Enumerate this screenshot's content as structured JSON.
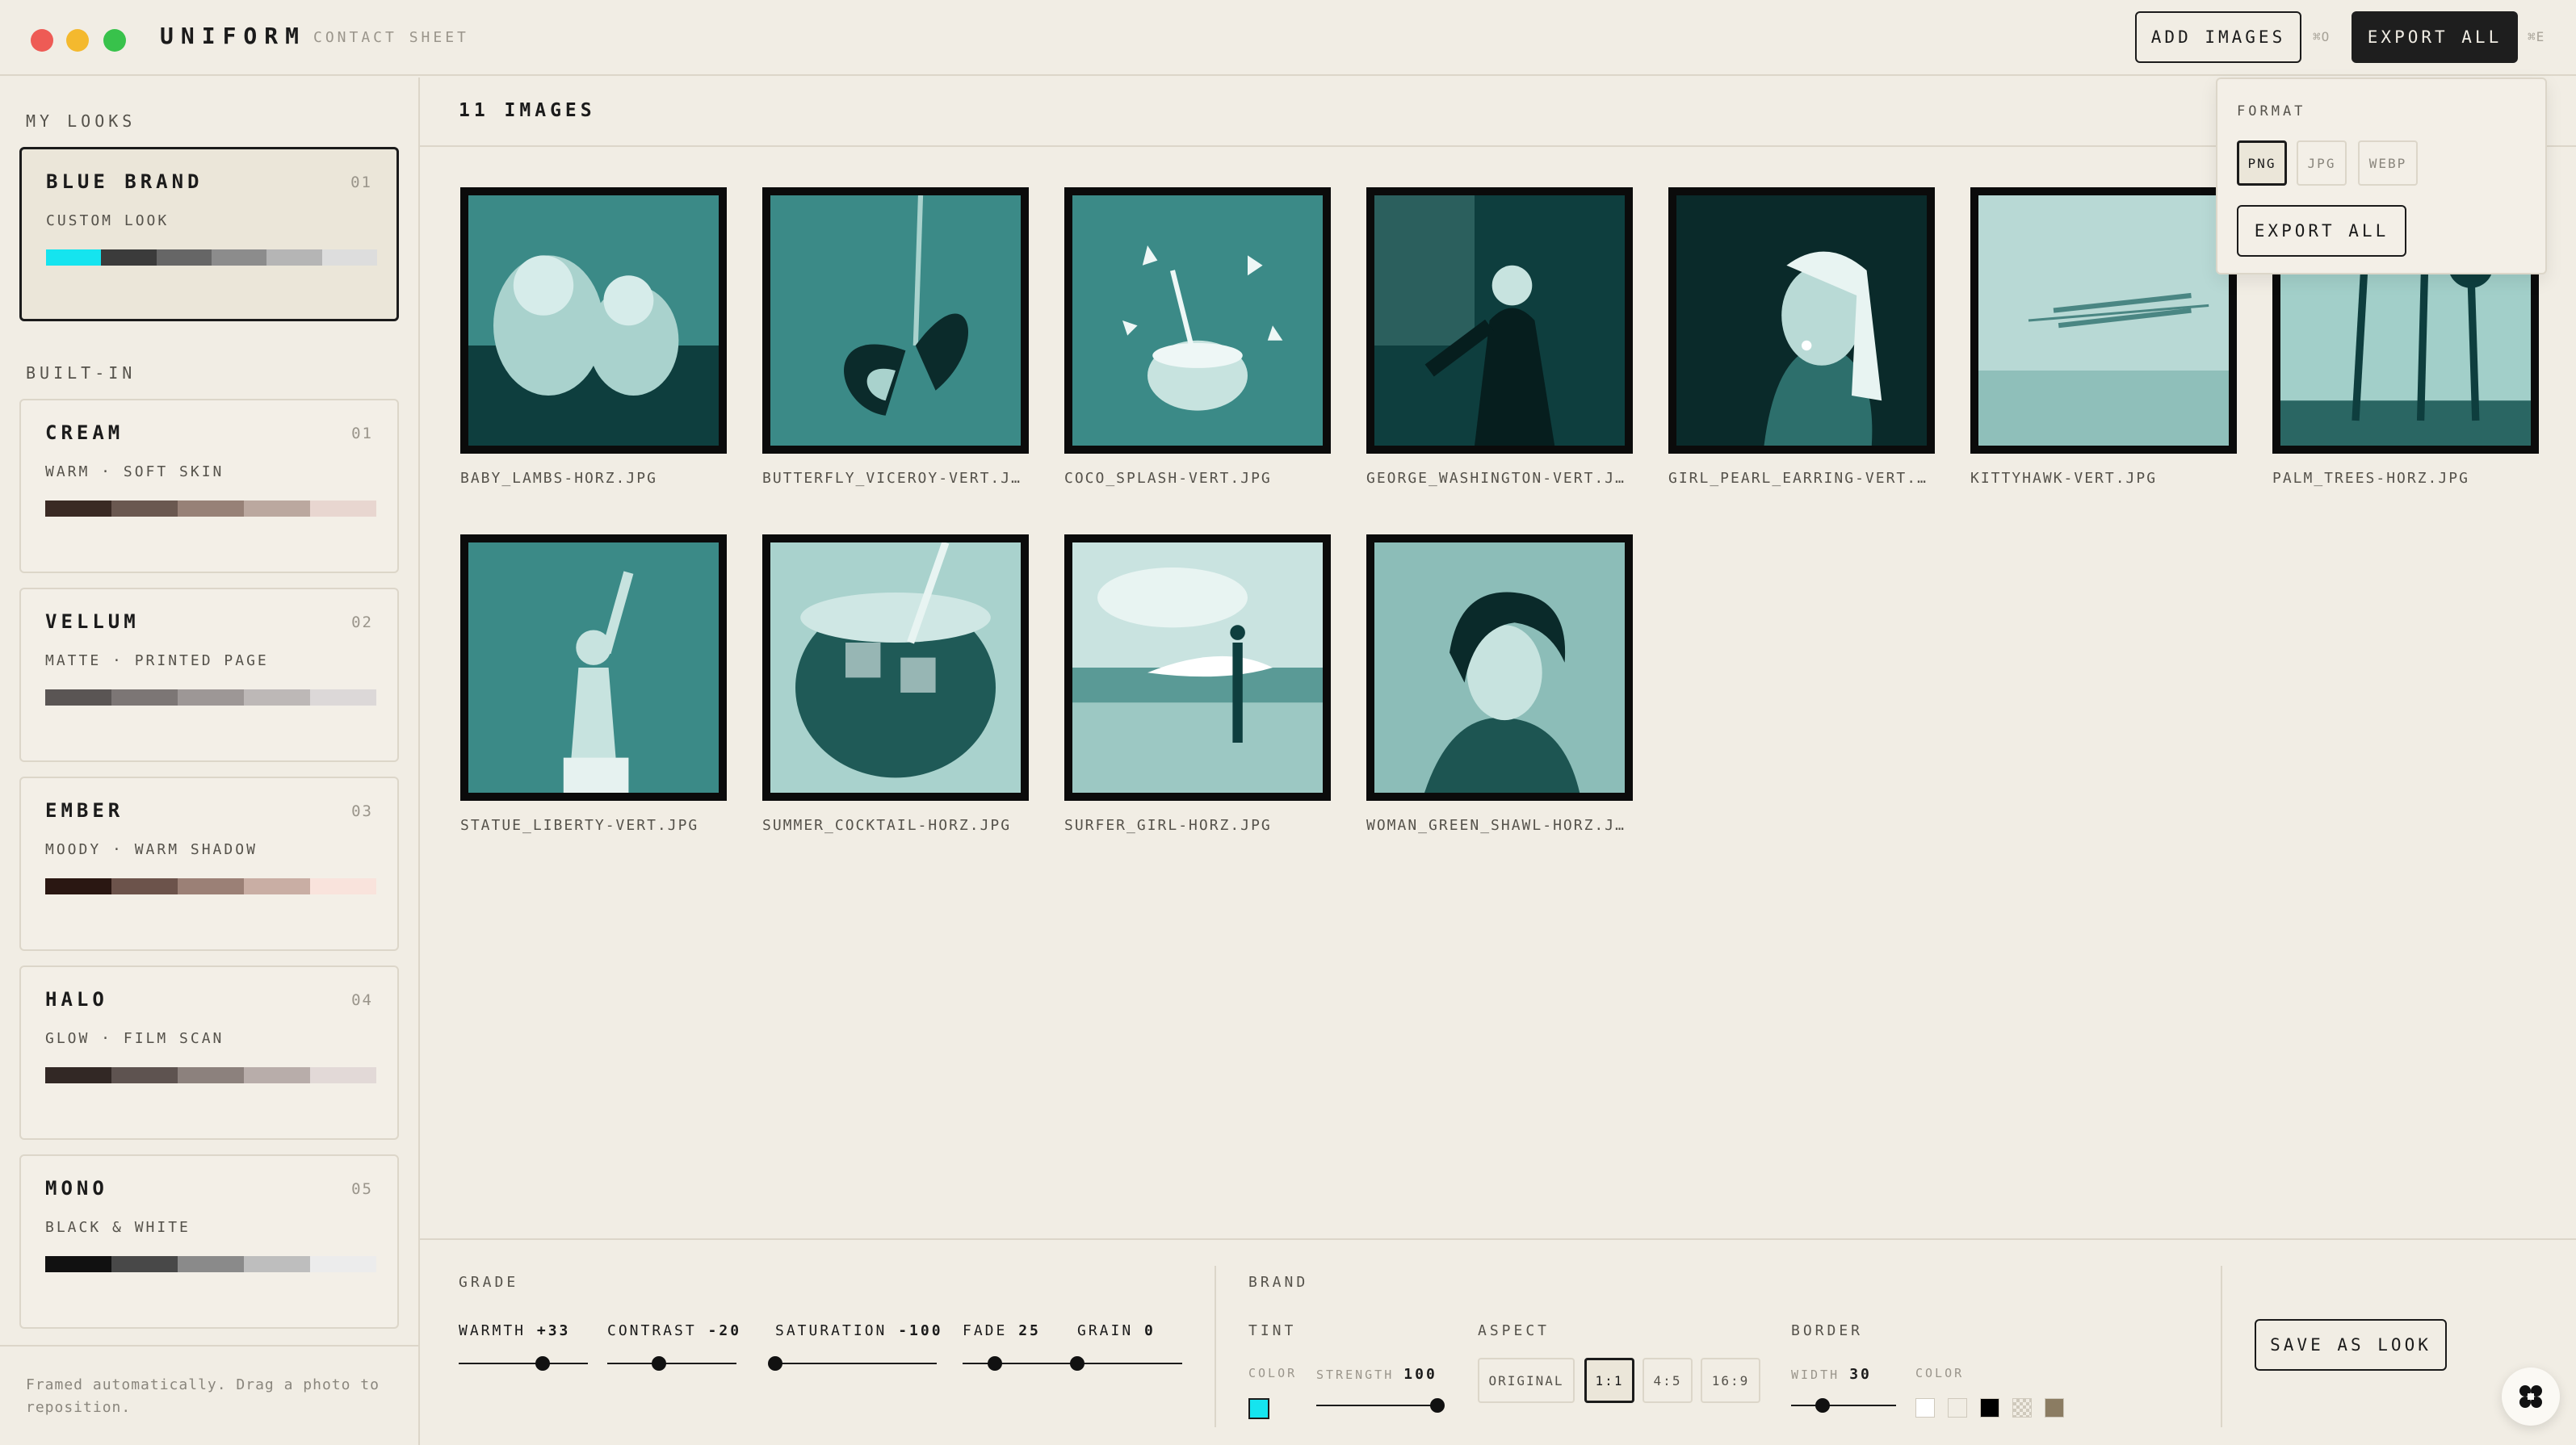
{
  "app": {
    "name": "UNIFORM",
    "subtitle": "CONTACT SHEET"
  },
  "toolbar": {
    "add_images_label": "ADD IMAGES",
    "add_images_shortcut": "⌘O",
    "export_all_label": "EXPORT ALL",
    "export_all_shortcut": "⌘E"
  },
  "sidebar": {
    "my_looks_label": "MY LOOKS",
    "built_in_label": "BUILT-IN",
    "my_looks": [
      {
        "name": "BLUE BRAND",
        "num": "01",
        "desc": "CUSTOM LOOK",
        "swatches": [
          "#15e4ef",
          "#3b3b3b",
          "#666666",
          "#8c8c8c",
          "#b5b5b5",
          "#dddddd"
        ]
      }
    ],
    "built_in": [
      {
        "name": "CREAM",
        "num": "01",
        "desc": "WARM · SOFT SKIN",
        "swatches": [
          "#3a2a24",
          "#6a5850",
          "#978177",
          "#bba89f",
          "#e8d6d0"
        ]
      },
      {
        "name": "VELLUM",
        "num": "02",
        "desc": "MATTE · PRINTED PAGE",
        "swatches": [
          "#5a5554",
          "#7c7675",
          "#9d9796",
          "#bdb8b7",
          "#dcd8d8"
        ]
      },
      {
        "name": "EMBER",
        "num": "03",
        "desc": "MOODY · WARM SHADOW",
        "swatches": [
          "#2a1712",
          "#6c534b",
          "#9b8076",
          "#c9aea4",
          "#f9e3dc"
        ]
      },
      {
        "name": "HALO",
        "num": "04",
        "desc": "GLOW · FILM SCAN",
        "swatches": [
          "#322825",
          "#5e5350",
          "#8c817d",
          "#b8adaa",
          "#e2d9d7"
        ]
      },
      {
        "name": "MONO",
        "num": "05",
        "desc": "BLACK & WHITE",
        "swatches": [
          "#111111",
          "#484848",
          "#8a8a8a",
          "#bebebe",
          "#ececec"
        ]
      }
    ],
    "footer_note": "Framed automatically. Drag a photo to reposition."
  },
  "main": {
    "image_count_label": "11 IMAGES",
    "images": [
      {
        "file": "BABY_LAMBS-HORZ.JPG",
        "subject": "lambs"
      },
      {
        "file": "BUTTERFLY_VICEROY-VERT.J…",
        "subject": "butterfly"
      },
      {
        "file": "COCO_SPLASH-VERT.JPG",
        "subject": "coconut"
      },
      {
        "file": "GEORGE_WASHINGTON-VERT.J…",
        "subject": "washington"
      },
      {
        "file": "GIRL_PEARL_EARRING-VERT.…",
        "subject": "pearl"
      },
      {
        "file": "KITTYHAWK-VERT.JPG",
        "subject": "plane"
      },
      {
        "file": "PALM_TREES-HORZ.JPG",
        "subject": "palms"
      },
      {
        "file": "STATUE_LIBERTY-VERT.JPG",
        "subject": "liberty"
      },
      {
        "file": "SUMMER_COCKTAIL-HORZ.JPG",
        "subject": "cocktail"
      },
      {
        "file": "SURFER_GIRL-HORZ.JPG",
        "subject": "surfer"
      },
      {
        "file": "WOMAN_GREEN_SHAWL-HORZ.J…",
        "subject": "woman"
      }
    ]
  },
  "export_menu": {
    "format_label": "FORMAT",
    "formats": [
      "PNG",
      "JPG",
      "WEBP"
    ],
    "selected_format": "PNG",
    "export_label": "EXPORT ALL"
  },
  "grade": {
    "label": "GRADE",
    "sliders": [
      {
        "name": "WARMTH",
        "value": "+33",
        "fraction": 0.65
      },
      {
        "name": "CONTRAST",
        "value": "-20",
        "fraction": 0.4
      },
      {
        "name": "SATURATION",
        "value": "-100",
        "fraction": 0.0
      },
      {
        "name": "FADE",
        "value": "25",
        "fraction": 0.25
      },
      {
        "name": "GRAIN",
        "value": "0",
        "fraction": 0.0
      }
    ]
  },
  "brand": {
    "label": "BRAND",
    "tint_label": "TINT",
    "color_label": "COLOR",
    "tint_color": "#15e4ef",
    "strength_label": "STRENGTH",
    "strength_value": "100",
    "strength_fraction": 1.0,
    "aspect_label": "ASPECT",
    "aspects": [
      "ORIGINAL",
      "1:1",
      "4:5",
      "16:9"
    ],
    "selected_aspect": "1:1",
    "border_label": "BORDER",
    "width_label": "WIDTH",
    "width_value": "30",
    "width_fraction": 0.3,
    "border_color_label": "COLOR",
    "border_colors": [
      "#ffffff",
      "#f1ede4",
      "#000000",
      "checker",
      "#8b7c62"
    ]
  },
  "save_look_label": "SAVE AS LOOK",
  "colors": {
    "background": "#f1ede4",
    "ink": "#1b1b1b",
    "tint": "#15e4ef",
    "photo_dark": "#0e3e3e",
    "photo_mid": "#3b8a87",
    "photo_light": "#a9d2cd"
  }
}
